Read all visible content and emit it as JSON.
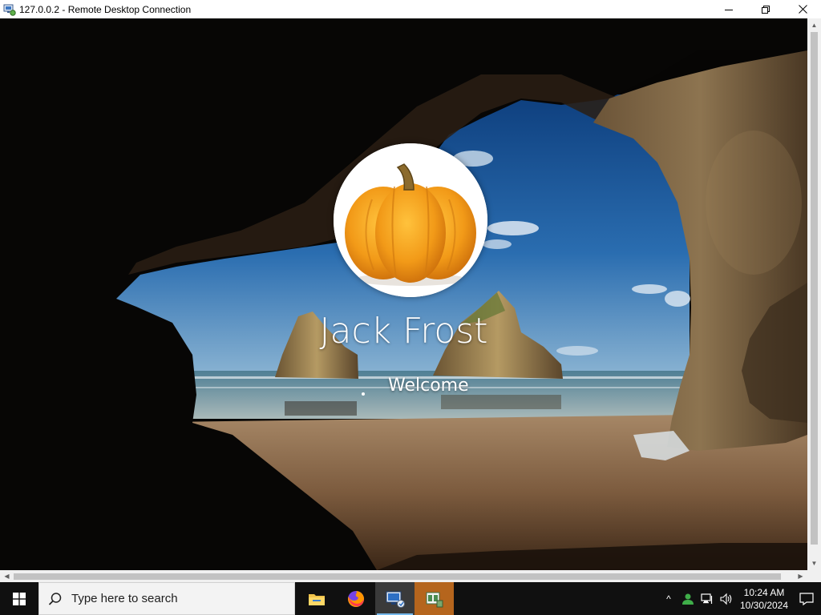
{
  "window": {
    "title": "127.0.0.2 - Remote Desktop Connection",
    "icon": "remote-desktop-icon",
    "controls": [
      "minimize-icon",
      "restore-icon",
      "close-icon"
    ]
  },
  "lock_screen": {
    "user_name": "Jack Frost",
    "status": "Welcome",
    "avatar": "pumpkin-avatar"
  },
  "scrollbars": {
    "vertical_arrows": [
      "▲",
      "▼"
    ],
    "horizontal_arrows": [
      "◀",
      "▶"
    ]
  },
  "taskbar": {
    "start_icon": "windows-start-icon",
    "search_placeholder": "Type here to search",
    "pinned_apps": [
      {
        "name": "file-explorer-icon",
        "active": false
      },
      {
        "name": "firefox-icon",
        "active": false
      },
      {
        "name": "remote-desktop-app-icon",
        "active": true
      },
      {
        "name": "server-manager-icon",
        "active": false
      }
    ],
    "tray": {
      "chevron": "^",
      "icons": [
        "user-status-icon",
        "network-icon",
        "volume-icon"
      ],
      "time": "10:24 AM",
      "date": "10/30/2024",
      "notification_icon": "action-center-icon"
    }
  }
}
